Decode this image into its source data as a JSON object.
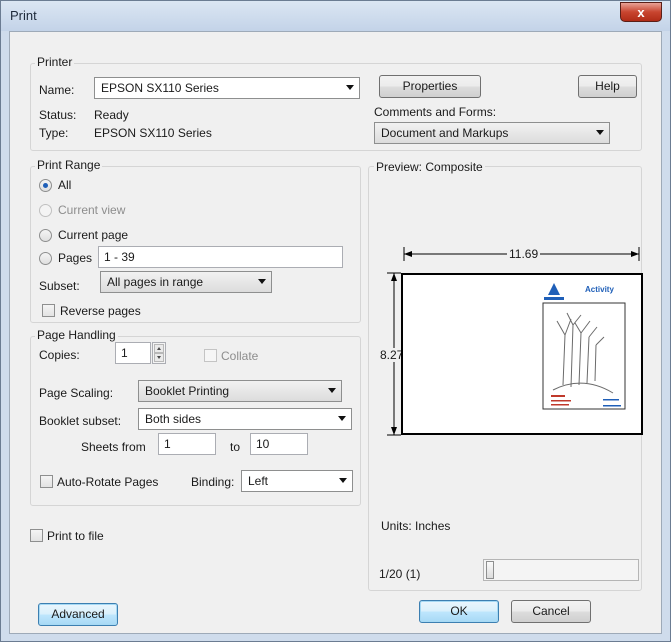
{
  "window": {
    "title": "Print",
    "close_glyph": "x"
  },
  "printer": {
    "group_label": "Printer",
    "name_label": "Name:",
    "name_value": "EPSON SX110 Series",
    "status_label": "Status:",
    "status_value": "Ready",
    "type_label": "Type:",
    "type_value": "EPSON SX110 Series",
    "properties_button": "Properties",
    "help_button": "Help",
    "comments_label": "Comments and Forms:",
    "comments_value": "Document and Markups"
  },
  "print_range": {
    "group_label": "Print Range",
    "all_label": "All",
    "current_view_label": "Current view",
    "current_page_label": "Current page",
    "pages_label": "Pages",
    "pages_value": "1 - 39",
    "subset_label": "Subset:",
    "subset_value": "All pages in range",
    "reverse_label": "Reverse pages"
  },
  "page_handling": {
    "group_label": "Page Handling",
    "copies_label": "Copies:",
    "copies_value": "1",
    "collate_label": "Collate",
    "scaling_label": "Page Scaling:",
    "scaling_value": "Booklet Printing",
    "booklet_label": "Booklet subset:",
    "booklet_value": "Both sides",
    "sheets_from_label": "Sheets from",
    "sheets_from_value": "1",
    "sheets_to_label": "to",
    "sheets_to_value": "10",
    "autorotate_label": "Auto-Rotate Pages",
    "binding_label": "Binding:",
    "binding_value": "Left"
  },
  "print_to_file_label": "Print to file",
  "preview": {
    "label": "Preview: Composite",
    "width_value": "11.69",
    "height_value": "8.27",
    "page_title": "Activity",
    "units_label": "Units: Inches",
    "page_counter": "1/20 (1)"
  },
  "footer": {
    "advanced_button": "Advanced",
    "ok_button": "OK",
    "cancel_button": "Cancel"
  },
  "colors": {
    "title_close": "#c8452f",
    "preview_accent": "#1f5fb8"
  }
}
